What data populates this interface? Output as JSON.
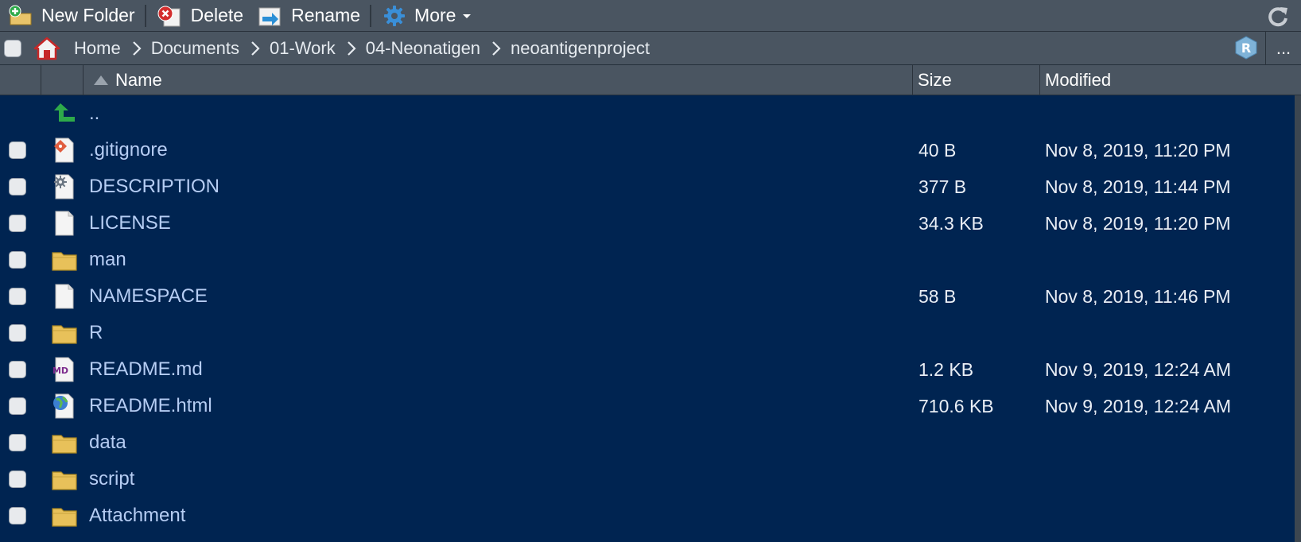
{
  "toolbar": {
    "new_folder_label": "New Folder",
    "delete_label": "Delete",
    "rename_label": "Rename",
    "more_label": "More"
  },
  "breadcrumb": [
    "Home",
    "Documents",
    "01-Work",
    "04-Neonatigen",
    "neoantigenproject"
  ],
  "pathbar_more": "...",
  "columns": {
    "name": "Name",
    "size": "Size",
    "modified": "Modified"
  },
  "parent": {
    "label": ".."
  },
  "files": [
    {
      "name": ".gitignore",
      "size": "40 B",
      "modified": "Nov 8, 2019, 11:20 PM",
      "icon": "git-file-icon"
    },
    {
      "name": "DESCRIPTION",
      "size": "377 B",
      "modified": "Nov 8, 2019, 11:44 PM",
      "icon": "gear-file-icon"
    },
    {
      "name": "LICENSE",
      "size": "34.3 KB",
      "modified": "Nov 8, 2019, 11:20 PM",
      "icon": "file-icon"
    },
    {
      "name": "man",
      "size": "",
      "modified": "",
      "icon": "folder-icon"
    },
    {
      "name": "NAMESPACE",
      "size": "58 B",
      "modified": "Nov 8, 2019, 11:46 PM",
      "icon": "file-icon"
    },
    {
      "name": "R",
      "size": "",
      "modified": "",
      "icon": "folder-icon"
    },
    {
      "name": "README.md",
      "size": "1.2 KB",
      "modified": "Nov 9, 2019, 12:24 AM",
      "icon": "markdown-file-icon"
    },
    {
      "name": "README.html",
      "size": "710.6 KB",
      "modified": "Nov 9, 2019, 12:24 AM",
      "icon": "globe-file-icon"
    },
    {
      "name": "data",
      "size": "",
      "modified": "",
      "icon": "folder-icon"
    },
    {
      "name": "script",
      "size": "",
      "modified": "",
      "icon": "folder-icon"
    },
    {
      "name": "Attachment",
      "size": "",
      "modified": "",
      "icon": "folder-icon"
    }
  ],
  "colors": {
    "background": "#002451",
    "toolbar": "#4a5561",
    "filename": "#b6cdf3"
  }
}
